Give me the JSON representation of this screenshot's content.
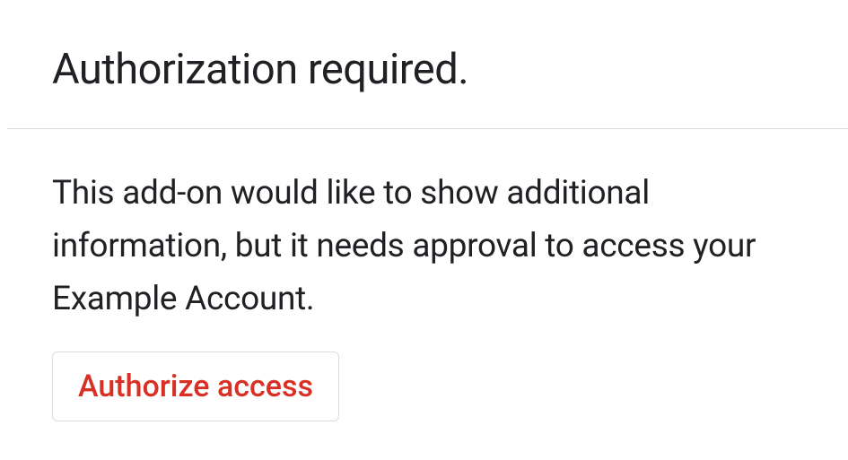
{
  "header": {
    "title": "Authorization required."
  },
  "body": {
    "description": "This add-on would like to show additional information, but it needs approval to access your Example Account.",
    "authorize_label": "Authorize access"
  }
}
